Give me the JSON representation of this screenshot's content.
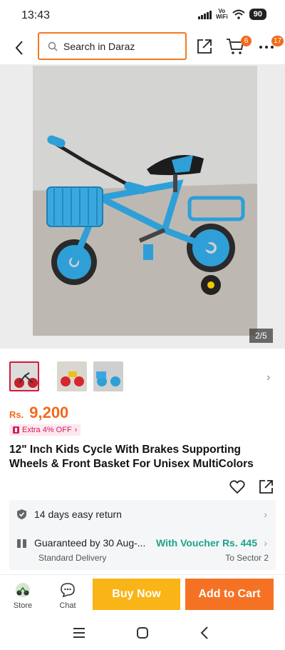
{
  "status_bar": {
    "time": "13:43",
    "network_label_top": "Vo",
    "network_label_bottom": "WiFi",
    "battery": "90"
  },
  "header": {
    "search_placeholder": "Search in Daraz",
    "cart_count": "6",
    "more_count": "17"
  },
  "gallery": {
    "page_indicator": "2/5",
    "image_description_icon": "kids-bicycle-photo",
    "selected_thumbnail": 1
  },
  "product": {
    "currency": "Rs.",
    "price": "9,200",
    "promo_label": "Extra 4% OFF",
    "title": "12\" Inch Kids Cycle With Brakes Supporting Wheels & Front Basket For Unisex MultiColors"
  },
  "service": {
    "return_policy": "14 days easy return",
    "guarantee": "Guaranteed by 30 Aug-...",
    "voucher": "With Voucher Rs. 445",
    "delivery_type": "Standard Delivery",
    "destination": "To Sector 2"
  },
  "bottom_bar": {
    "store_label": "Store",
    "chat_label": "Chat",
    "buy_now_label": "Buy Now",
    "add_to_cart_label": "Add to Cart"
  },
  "colors": {
    "accent_orange": "#f57224",
    "buy_now_yellow": "#f9b417",
    "voucher_green": "#1aa48a",
    "promo_pink": "#d11c5c"
  }
}
